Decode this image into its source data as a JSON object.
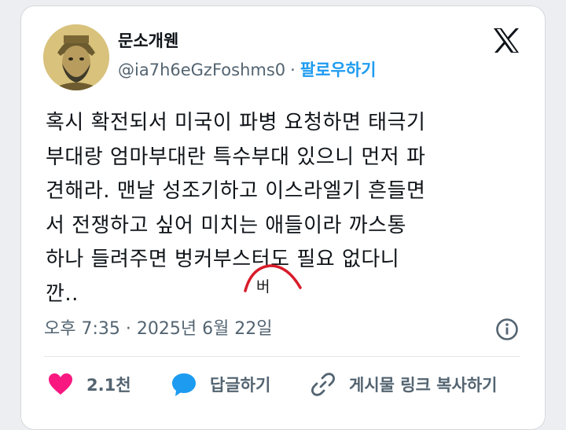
{
  "user": {
    "display_name": "문소개웬",
    "handle": "@ia7h6eGzFoshms0",
    "separator": "·",
    "follow_label": "팔로우하기"
  },
  "tweet": {
    "text": "혹시 확전되서 미국이 파병 요청하면 태극기\n부대랑 엄마부대란 특수부대 있으니 먼저 파\n견해라. 맨날 성조기하고 이스라엘기 흔들면\n서 전쟁하고 싶어 미치는 애들이라 까스통\n하나 들려주면 벙커부스터도 필요 없다니\n깐..",
    "timestamp": "오후 7:35 · 2025년 6월 22일",
    "annotation": "버"
  },
  "actions": {
    "likes_label": "2.1천",
    "reply_label": "답글하기",
    "share_label": "게시물 링크 복사하기"
  },
  "colors": {
    "accent": "#1d9bf0",
    "like": "#f91880",
    "reply": "#1d9bf0",
    "annotation": "#d91b2a"
  },
  "icons": {
    "logo": "x-logo-icon",
    "info": "info-icon",
    "like": "heart-icon",
    "reply": "speech-bubble-icon",
    "share": "link-icon"
  }
}
